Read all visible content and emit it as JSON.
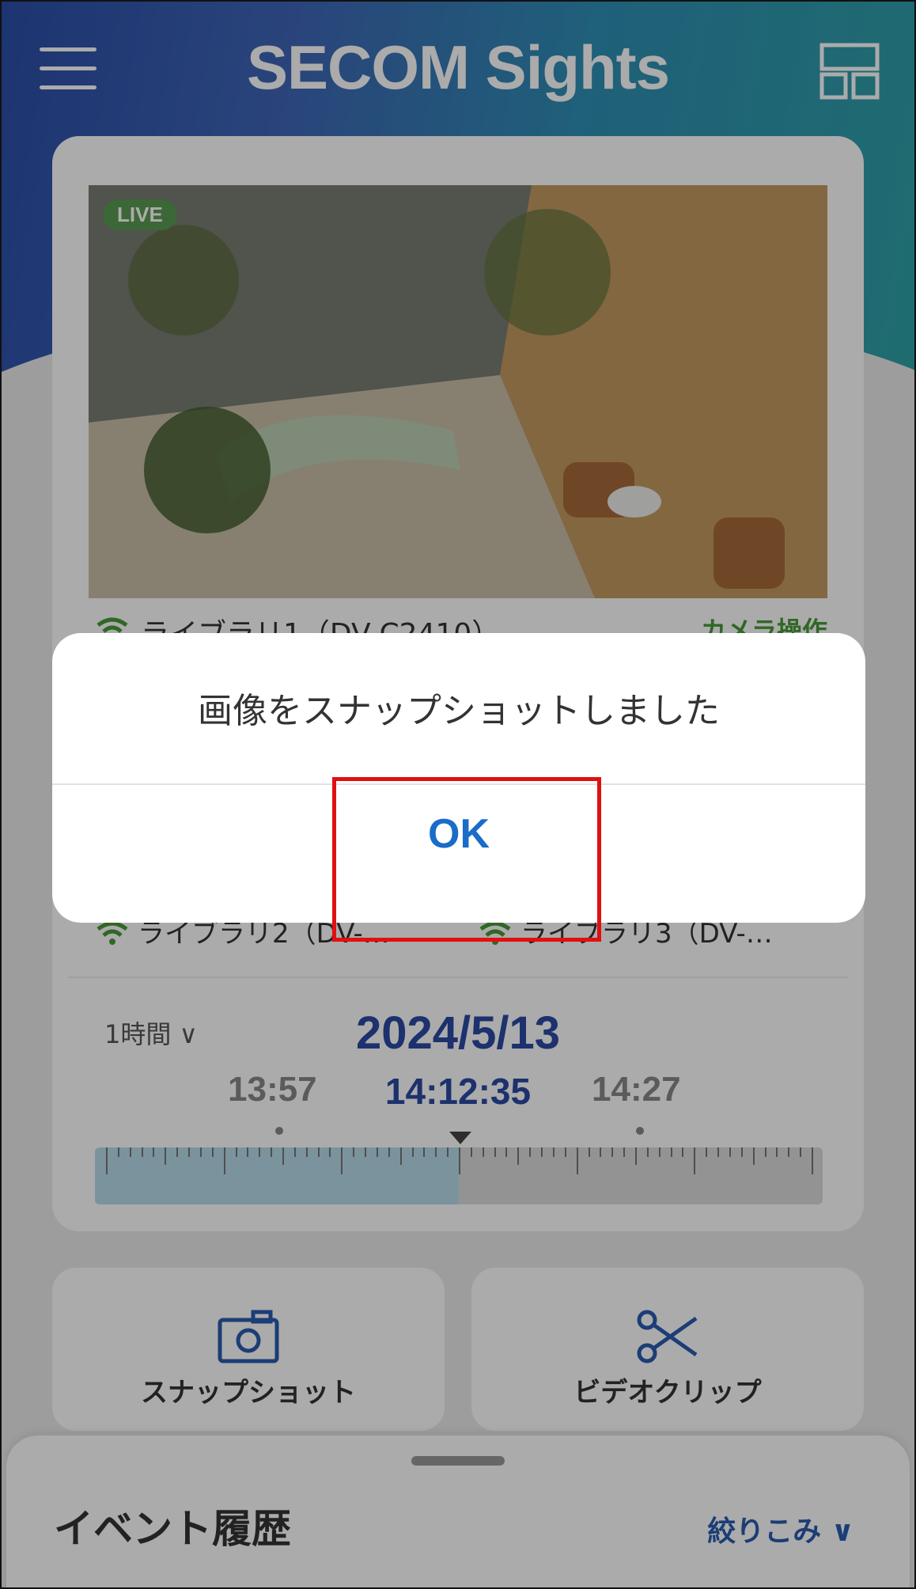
{
  "header": {
    "title": "SECOM Sights",
    "menu_icon": "hamburger-icon",
    "layout_icon": "layout-grid-icon"
  },
  "camera": {
    "live_badge": "LIVE",
    "name": "ライブラリ1（DV-C2410）",
    "operation_label": "カメラ操作"
  },
  "thumbnails": [
    {
      "name": "ライブラリ2（DV-…"
    },
    {
      "name": "ライブラリ3（DV-…"
    }
  ],
  "timeline": {
    "range": "1時間",
    "date": "2024/5/13",
    "time_left": "13:57",
    "time_center": "14:12:35",
    "time_right": "14:27",
    "played_fraction": 0.5
  },
  "actions": {
    "snapshot_label": "スナップショット",
    "snapshot_icon": "camera-icon",
    "clip_label": "ビデオクリップ",
    "clip_icon": "scissors-icon"
  },
  "events": {
    "title": "イベント履歴",
    "filter_label": "絞りこみ"
  },
  "dialog": {
    "message": "画像をスナップショットしました",
    "ok_label": "OK"
  },
  "colors": {
    "accent": "#1a6cc9",
    "live": "#5a9a52",
    "date": "#2a4aa3",
    "highlight": "#e01010"
  }
}
